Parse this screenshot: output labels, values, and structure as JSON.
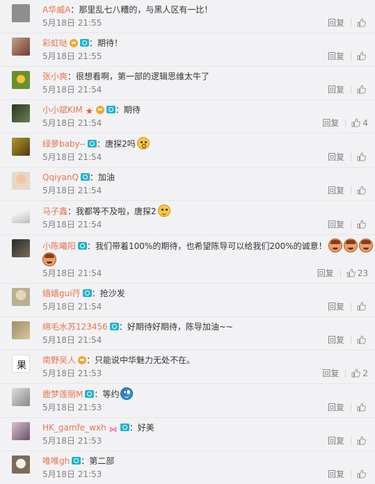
{
  "comments": [
    {
      "name": "A华威A",
      "text": "：那里乱七八糟的，与黑人区有一比！",
      "time": "5月18日 21:55",
      "reply": "回复",
      "likes": ""
    },
    {
      "name": "彩虹哒",
      "text": "：期待！",
      "time": "5月18日 21:55",
      "reply": "回复",
      "likes": ""
    },
    {
      "name": "张小爽",
      "text": "：很想看啊，第一部的逻辑思维太牛了",
      "time": "5月18日 21:54",
      "reply": "回复",
      "likes": ""
    },
    {
      "name": "小小斌KIM",
      "text": "：期待",
      "time": "5月18日 21:54",
      "reply": "回复",
      "likes": "4"
    },
    {
      "name": "绿萝baby--",
      "text": "：唐探2吗",
      "time": "5月18日 21:54",
      "reply": "回复",
      "likes": ""
    },
    {
      "name": "QqiyanQ",
      "text": "：加油",
      "time": "5月18日 21:54",
      "reply": "回复",
      "likes": ""
    },
    {
      "name": "马子鑫",
      "text": "：我都等不及啦，唐探2",
      "time": "5月18日 21:54",
      "reply": "回复",
      "likes": ""
    },
    {
      "name": "小陈曦阳",
      "text": "：我们带着100%的期待，也希望陈导可以给我们200%的诚意！",
      "time": "5月18日 21:54",
      "reply": "回复",
      "likes": "23"
    },
    {
      "name": "嫱嫱gui荇",
      "text": "：抢沙发",
      "time": "5月18日 21:54",
      "reply": "回复",
      "likes": ""
    },
    {
      "name": "绵毛水苏123456",
      "text": "：好期待好期待，陈导加油~~",
      "time": "5月18日 21:54",
      "reply": "回复",
      "likes": ""
    },
    {
      "name": "南野吴人",
      "text": "：只能说中华魅力无处不在。",
      "time": "5月18日 21:53",
      "reply": "回复",
      "likes": "2"
    },
    {
      "name": "鹿梦莲丽M",
      "text": "：等约",
      "time": "5月18日 21:53",
      "reply": "回复",
      "likes": ""
    },
    {
      "name": "HK_gamfe_wxh",
      "text": "：好美",
      "time": "5月18日 21:53",
      "reply": "回复",
      "likes": ""
    },
    {
      "name": "唯唯gh",
      "text": "：第二部",
      "time": "5月18日 21:53",
      "reply": "回复",
      "likes": ""
    }
  ]
}
